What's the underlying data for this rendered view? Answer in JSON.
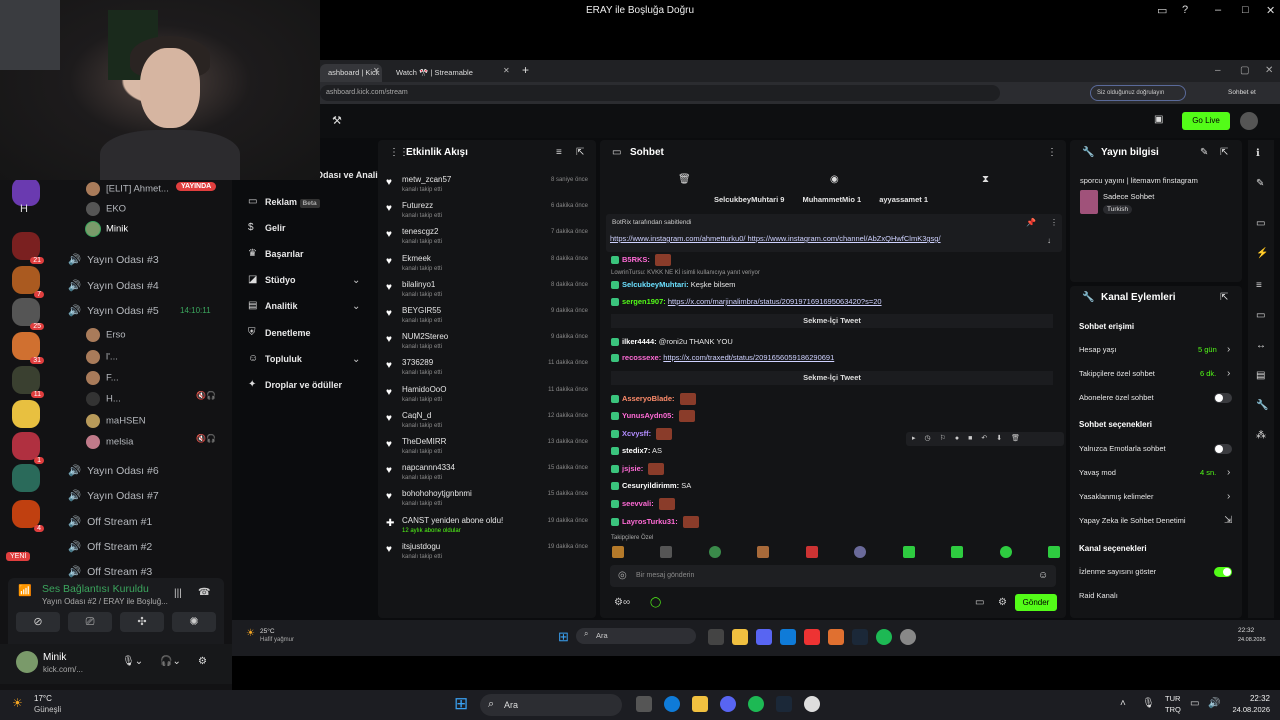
{
  "window": {
    "title": "ERAY ile Boşluğa Doğru"
  },
  "browser": {
    "tabs": [
      {
        "label": "ashboard | Kick"
      },
      {
        "label": "Watch 🎌 | Streamable"
      }
    ],
    "url": "ashboard.kick.com/stream",
    "ext_label": "Siz olduğunuz doğrulayın",
    "profile": "Sohbet et"
  },
  "kick": {
    "go_live": "Go Live",
    "nav": [
      {
        "label": "Yayın Odası ve Analiz"
      },
      {
        "label": "Reklam",
        "badge": "Beta"
      },
      {
        "label": "Gelir"
      },
      {
        "label": "Başarılar"
      },
      {
        "label": "Stüdyo"
      },
      {
        "label": "Analitik"
      },
      {
        "label": "Denetleme"
      },
      {
        "label": "Topluluk"
      },
      {
        "label": "Droplar ve ödüller"
      }
    ],
    "events": {
      "title": "Etkinlik Akışı",
      "items": [
        {
          "name": "metw_zcan57",
          "sub": "kanalı takip etti",
          "time": "8 saniye önce"
        },
        {
          "name": "Futurezz",
          "sub": "kanalı takip etti",
          "time": "6 dakika önce"
        },
        {
          "name": "tenescgz2",
          "sub": "kanalı takip etti",
          "time": "7 dakika önce"
        },
        {
          "name": "Ekmeek",
          "sub": "kanalı takip etti",
          "time": "8 dakika önce"
        },
        {
          "name": "bilalinyo1",
          "sub": "kanalı takip etti",
          "time": "8 dakika önce"
        },
        {
          "name": "BEYGIR55",
          "sub": "kanalı takip etti",
          "time": "9 dakika önce"
        },
        {
          "name": "NUM2Stereo",
          "sub": "kanalı takip etti",
          "time": "9 dakika önce"
        },
        {
          "name": "3736289",
          "sub": "kanalı takip etti",
          "time": "11 dakika önce"
        },
        {
          "name": "HamidoOoO",
          "sub": "kanalı takip etti",
          "time": "11 dakika önce"
        },
        {
          "name": "CaqN_d",
          "sub": "kanalı takip etti",
          "time": "12 dakika önce"
        },
        {
          "name": "TheDeMIRR",
          "sub": "kanalı takip etti",
          "time": "13 dakika önce"
        },
        {
          "name": "napcannn4334",
          "sub": "kanalı takip etti",
          "time": "15 dakika önce"
        },
        {
          "name": "bohohohoytjgnbnmi",
          "sub": "kanalı takip etti",
          "time": "15 dakika önce"
        },
        {
          "name": "CANST yeniden abone oldu!",
          "sub": "12 aylık abone oldular",
          "time": "19 dakika önce"
        },
        {
          "name": "itsjustdogu",
          "sub": "kanalı takip etti",
          "time": "19 dakika önce"
        }
      ]
    },
    "chat": {
      "title": "Sohbet",
      "top": [
        "SelcukbeyMuhtari 9",
        "MuhammetMio 1",
        "ayyassamet 1"
      ],
      "pinned_by": "BotRix tarafından sabitlendi",
      "pinned_link": "https://www.instagram.com/ahmetturku0/ https://www.instagram.com/channel/AbZxQHwfClmK3gsg/",
      "reply_note": "LowrinTursu: KVKK NE Kİ isimli kullanıcıya yanıt veriyor",
      "tweet_label": "Sekme-İçi Tweet",
      "messages": [
        {
          "user": "B5RKS:",
          "text": ""
        },
        {
          "user": "SelcukbeyMuhtari:",
          "text": "Keşke bilsem"
        },
        {
          "user": "sergen1907:",
          "text": "https://x.com/marjinalimbra/status/2091971691695063420?s=20"
        },
        {
          "user": "ilker4444:",
          "text": "@roni2u THANK YOU"
        },
        {
          "user": "recossexe:",
          "text": "https://x.com/traxedt/status/2091656059186290691"
        },
        {
          "user": "AsseryoBlade:",
          "text": ""
        },
        {
          "user": "YunusAydn05:",
          "text": ""
        },
        {
          "user": "Xcvysff:",
          "text": ""
        },
        {
          "user": "stedix7:",
          "text": "AS"
        },
        {
          "user": "jsjsie:",
          "text": ""
        },
        {
          "user": "Cesuryildirimm:",
          "text": "SA"
        },
        {
          "user": "seevvali:",
          "text": ""
        },
        {
          "user": "LayrosTurku31:",
          "text": ""
        }
      ],
      "followers_only": "Takipçilere Özel",
      "placeholder": "Bir mesaj gönderin",
      "send": "Gönder"
    },
    "info": {
      "title": "Yayın bilgisi",
      "stream_title": "sporcu yayını | litemavm finstagram",
      "category": "Sadece Sohbet",
      "lang": "Turkish"
    },
    "actions": {
      "title": "Kanal Eylemleri",
      "chat_access": "Sohbet erişimi",
      "rows1": [
        {
          "label": "Hesap yaşı",
          "value": "5 gün"
        },
        {
          "label": "Takipçilere özel sohbet",
          "value": "6 dk."
        },
        {
          "label": "Abonelere özel sohbet",
          "value": ""
        }
      ],
      "chat_options": "Sohbet seçenekleri",
      "rows2": [
        {
          "label": "Yalnızca Emotlarla sohbet",
          "value": ""
        },
        {
          "label": "Yavaş mod",
          "value": "4 sn."
        },
        {
          "label": "Yasaklanmış kelimeler",
          "value": ""
        },
        {
          "label": "Yapay Zeka ile Sohbet Denetimi",
          "value": ""
        }
      ],
      "channel_options": "Kanal seçenekleri",
      "rows3": [
        {
          "label": "İzlenme sayısını göster"
        },
        {
          "label": "Raid Kanalı"
        }
      ]
    }
  },
  "discord": {
    "users_top": [
      {
        "name": "[ELIT] Ahmet...",
        "badge": "YAYINDA"
      },
      {
        "name": "EKO"
      },
      {
        "name": "Minik"
      }
    ],
    "channels": [
      {
        "name": "Yayın Odası #3"
      },
      {
        "name": "Yayın Odası #4"
      },
      {
        "name": "Yayın Odası #5",
        "time": "14:10:11"
      }
    ],
    "users5": [
      "Erso",
      "l'...",
      "F...",
      "H...",
      "maHSEN",
      "melsia"
    ],
    "channels2": [
      "Yayın Odası #6",
      "Yayın Odası #7",
      "Off Stream #1",
      "Off Stream #2",
      "Off Stream #3"
    ],
    "voice_status": "Ses Bağlantısı Kuruldu",
    "voice_sub": "Yayın Odası #2 / ERAY ile Boşluğ...",
    "me_name": "Minik",
    "me_sub": "kick.com/...",
    "server_letter": "H",
    "new_badge": "YENİ"
  },
  "inner_taskbar": {
    "weather": "25°C",
    "weather_sub": "Hafif yağmur",
    "search": "Ara",
    "time": "22:32",
    "date": "24.08.2026"
  },
  "taskbar": {
    "weather": "17°C",
    "weather_sub": "Güneşli",
    "search": "Ara",
    "lang": "TUR",
    "lang2": "TRQ",
    "time": "22:32",
    "date": "24.08.2026"
  }
}
